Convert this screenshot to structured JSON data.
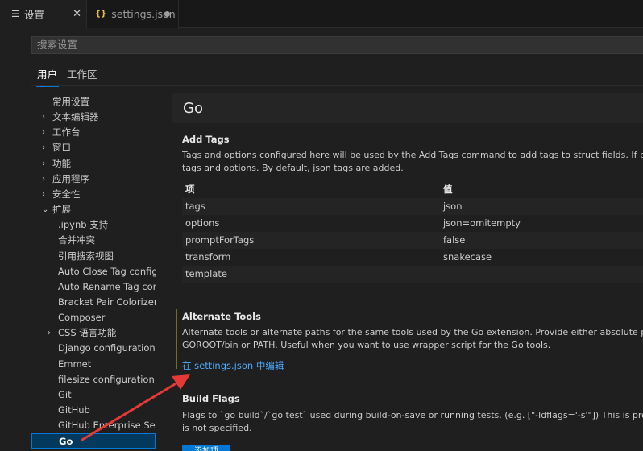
{
  "tabs": {
    "settings": {
      "label": "设置",
      "close": "✕"
    },
    "json": {
      "label": "settings.json",
      "icon": "{}"
    }
  },
  "search": {
    "placeholder": "搜索设置"
  },
  "scopes": {
    "user": "用户",
    "workspace": "工作区"
  },
  "toc": [
    {
      "label": "常用设置",
      "chevron": "",
      "indent": 1
    },
    {
      "label": "文本编辑器",
      "chevron": "›",
      "indent": 1
    },
    {
      "label": "工作台",
      "chevron": "›",
      "indent": 1
    },
    {
      "label": "窗口",
      "chevron": "›",
      "indent": 1
    },
    {
      "label": "功能",
      "chevron": "›",
      "indent": 1
    },
    {
      "label": "应用程序",
      "chevron": "›",
      "indent": 1
    },
    {
      "label": "安全性",
      "chevron": "›",
      "indent": 1
    },
    {
      "label": "扩展",
      "chevron": "⌄",
      "indent": 1
    },
    {
      "label": ".ipynb 支持",
      "chevron": "",
      "indent": 2
    },
    {
      "label": "合并冲突",
      "chevron": "",
      "indent": 2
    },
    {
      "label": "引用搜索视图",
      "chevron": "",
      "indent": 2
    },
    {
      "label": "Auto Close Tag config...",
      "chevron": "",
      "indent": 2
    },
    {
      "label": "Auto Rename Tag con...",
      "chevron": "",
      "indent": 2
    },
    {
      "label": "Bracket Pair Colorizer 2",
      "chevron": "",
      "indent": 2
    },
    {
      "label": "Composer",
      "chevron": "",
      "indent": 2
    },
    {
      "label": "CSS 语言功能",
      "chevron": "›",
      "indent": 2
    },
    {
      "label": "Django configuration",
      "chevron": "",
      "indent": 2
    },
    {
      "label": "Emmet",
      "chevron": "",
      "indent": 2
    },
    {
      "label": "filesize configuration",
      "chevron": "",
      "indent": 2
    },
    {
      "label": "Git",
      "chevron": "",
      "indent": 2
    },
    {
      "label": "GitHub",
      "chevron": "",
      "indent": 2
    },
    {
      "label": "GitHub Enterprise Ser...",
      "chevron": "",
      "indent": 2
    },
    {
      "label": "Go",
      "chevron": "",
      "indent": 2,
      "active": true
    }
  ],
  "main": {
    "title": "Go",
    "add_tags": {
      "title": "Add Tags",
      "desc_line1": "Tags and options configured here will be used by the Add Tags command to add tags to struct fields. If promptForT",
      "desc_line2": "tags and options. By default, json tags are added.",
      "header_key": "项",
      "header_value": "值",
      "rows": [
        {
          "key": "tags",
          "value": "json"
        },
        {
          "key": "options",
          "value": "json=omitempty"
        },
        {
          "key": "promptForTags",
          "value": "false"
        },
        {
          "key": "transform",
          "value": "snakecase"
        },
        {
          "key": "template",
          "value": ""
        }
      ]
    },
    "alternate_tools": {
      "title": "Alternate Tools",
      "desc_line1": "Alternate tools or alternate paths for the same tools used by the Go extension. Provide either absolute path or the",
      "desc_line2": "GOROOT/bin or PATH. Useful when you want to use wrapper script for the Go tools.",
      "link": "在 settings.json 中编辑"
    },
    "build_flags": {
      "title": "Build Flags",
      "desc_line1": "Flags to `go build`/`go test` used during build-on-save or running tests. (e.g. [\"-ldflags='-s'\"]) This is propagated to",
      "desc_line2": "is not specified.",
      "add_button": "添加项"
    }
  },
  "colors": {
    "accent": "#0078d4",
    "link": "#4daafc",
    "arrow": "#e53935"
  }
}
